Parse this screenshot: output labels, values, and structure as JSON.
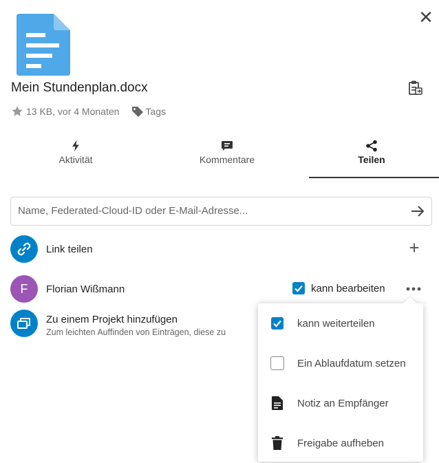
{
  "header": {
    "close_icon": "close-icon",
    "filename": "Mein Stundenplan.docx",
    "clipboard_icon": "clipboard-icon",
    "meta": {
      "size_age": "13 KB, vor 4 Monaten",
      "tags_label": "Tags"
    }
  },
  "tabs": [
    {
      "label": "Aktivität",
      "icon": "activity-bolt-icon",
      "active": false
    },
    {
      "label": "Kommentare",
      "icon": "comment-icon",
      "active": false
    },
    {
      "label": "Teilen",
      "icon": "share-icon",
      "active": true
    }
  ],
  "sharing": {
    "search_placeholder": "Name, Federated-Cloud-ID oder E-Mail-Adresse...",
    "link_share": {
      "label": "Link teilen"
    },
    "share_entry": {
      "avatar_letter": "F",
      "name": "Florian Wißmann",
      "can_edit_label": "kann bearbeiten",
      "can_edit_checked": true
    },
    "project": {
      "title": "Zu einem Projekt hinzufügen",
      "subtitle": "Zum leichten Auffinden von Einträgen, diese zu"
    }
  },
  "menu": {
    "items": [
      {
        "label": "kann weiterteilen",
        "type": "checkbox",
        "checked": true
      },
      {
        "label": "Ein Ablaufdatum setzen",
        "type": "checkbox",
        "checked": false
      },
      {
        "label": "Notiz an Empfänger",
        "type": "action",
        "icon": "note-icon"
      },
      {
        "label": "Freigabe aufheben",
        "type": "action",
        "icon": "trash-icon"
      }
    ]
  },
  "colors": {
    "accent": "#0082c9",
    "file_icon": "#4fa8e8",
    "avatar_user": "#9a55b5",
    "link_avatar": "#0082c9"
  }
}
